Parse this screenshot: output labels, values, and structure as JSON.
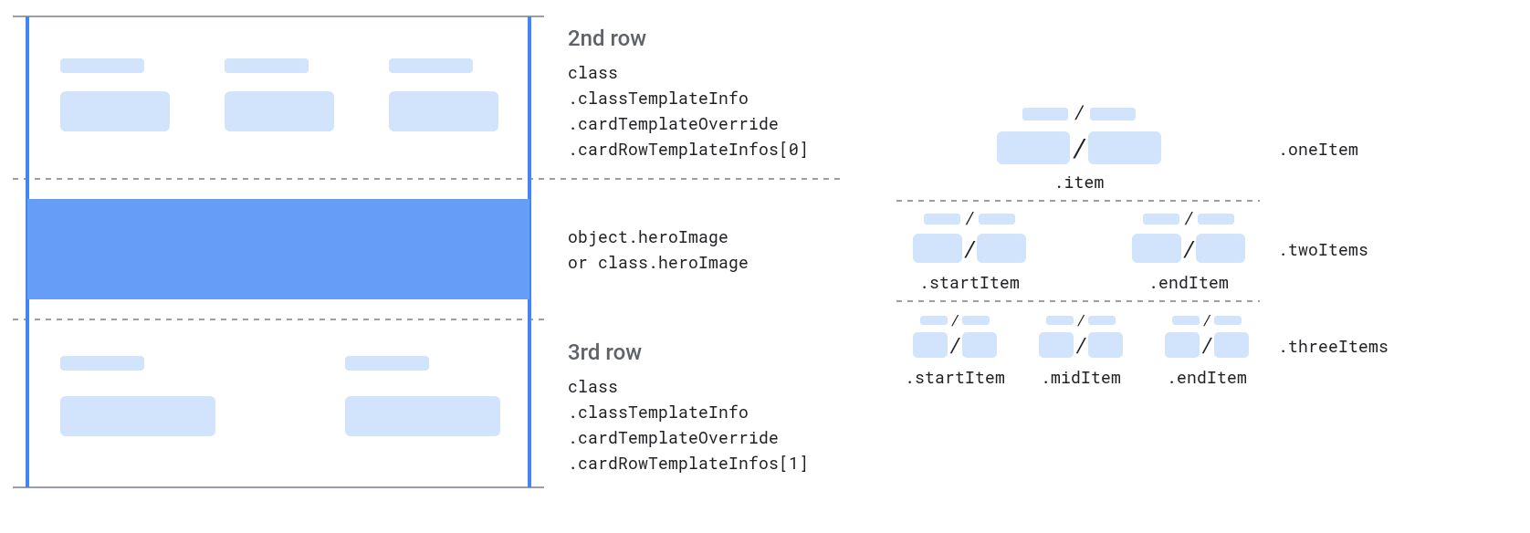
{
  "left": {
    "row2": {
      "title": "2nd row",
      "line1": "class",
      "line2": ".classTemplateInfo",
      "line3": ".cardTemplateOverride",
      "line4": ".cardRowTemplateInfos[0]"
    },
    "hero": {
      "line1": "object.heroImage",
      "line2": "or class.heroImage"
    },
    "row3": {
      "title": "3rd row",
      "line1": "class",
      "line2": ".classTemplateInfo",
      "line3": ".cardTemplateOverride",
      "line4": ".cardRowTemplateInfos[1]"
    }
  },
  "right": {
    "one": {
      "rowLabel": ".oneItem",
      "itemLabel": ".item"
    },
    "two": {
      "rowLabel": ".twoItems",
      "startLabel": ".startItem",
      "endLabel": ".endItem"
    },
    "three": {
      "rowLabel": ".threeItems",
      "startLabel": ".startItem",
      "midLabel": ".midItem",
      "endLabel": ".endItem"
    }
  }
}
